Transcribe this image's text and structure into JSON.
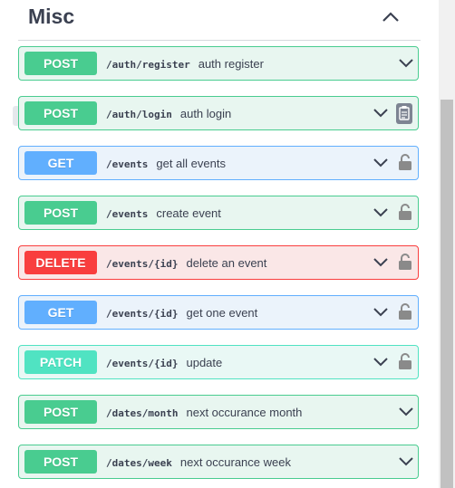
{
  "section": {
    "title": "Misc"
  },
  "operations": [
    {
      "method": "POST",
      "path": "/auth/register",
      "summary": "auth register"
    },
    {
      "method": "POST",
      "path": "/auth/login",
      "summary": "auth login"
    },
    {
      "method": "GET",
      "path": "/events",
      "summary": "get all events"
    },
    {
      "method": "POST",
      "path": "/events",
      "summary": "create event"
    },
    {
      "method": "DELETE",
      "path": "/events/{id}",
      "summary": "delete an event"
    },
    {
      "method": "GET",
      "path": "/events/{id}",
      "summary": "get one event"
    },
    {
      "method": "PATCH",
      "path": "/events/{id}",
      "summary": "update"
    },
    {
      "method": "POST",
      "path": "/dates/month",
      "summary": "next occurance month"
    },
    {
      "method": "POST",
      "path": "/dates/week",
      "summary": "next occurance week"
    }
  ],
  "colors": {
    "post": "#49cc90",
    "get": "#61affe",
    "delete": "#f93e3e",
    "patch": "#50e3c2",
    "text": "#3b4151"
  },
  "icons": {
    "collapse": "chevron-up-icon",
    "expand": "chevron-down-icon",
    "auth": "lock-icon",
    "copy": "clipboard-icon"
  }
}
